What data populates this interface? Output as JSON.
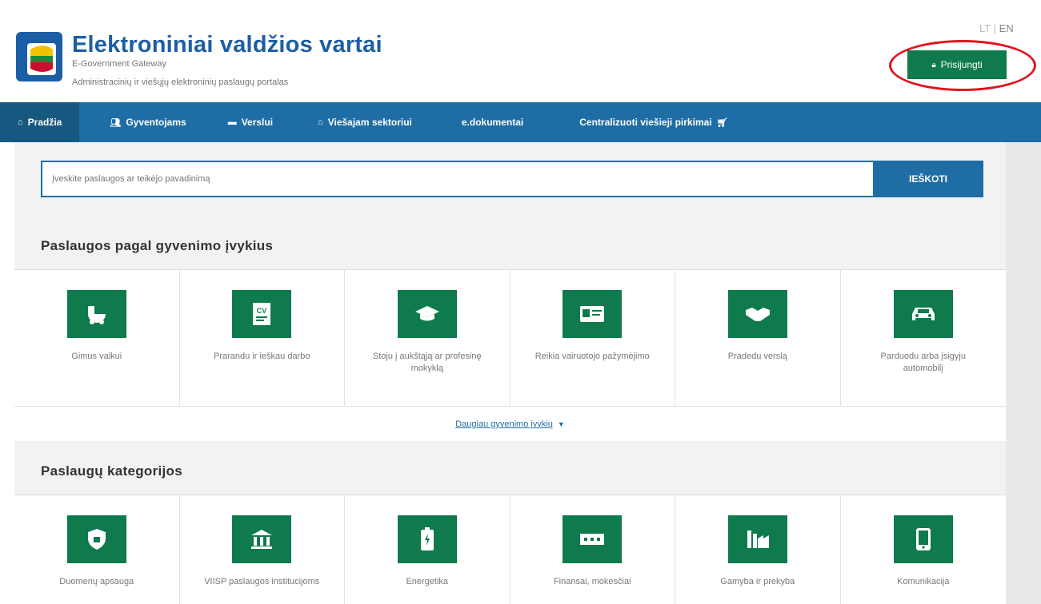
{
  "header": {
    "title": "Elektroniniai valdžios vartai",
    "subtitle": "E-Government Gateway",
    "subtitle2": "Administracinių ir viešųjų elektroninių paslaugų portalas",
    "lang_lt": "LT",
    "lang_en": "EN",
    "login_label": "Prisijungti"
  },
  "nav": {
    "items": [
      {
        "label": "Pradžia",
        "icon": "home-icon"
      },
      {
        "label": "Gyventojams",
        "icon": "people-icon"
      },
      {
        "label": "Verslui",
        "icon": "briefcase-icon"
      },
      {
        "label": "Viešajam sektoriui",
        "icon": "institution-icon"
      },
      {
        "label": "e.dokumentai",
        "icon": ""
      },
      {
        "label": "Centralizuoti viešieji pirkimai",
        "icon": "cart-icon"
      }
    ]
  },
  "search": {
    "placeholder": "Įveskite paslaugos ar teikėjo pavadinimą",
    "button_label": "IEŠKOTI"
  },
  "life_events": {
    "title": "Paslaugos pagal gyvenimo įvykius",
    "items": [
      {
        "label": "Gimus vaikui",
        "icon": "stroller-icon"
      },
      {
        "label": "Prarandu ir ieškau darbo",
        "icon": "cv-icon"
      },
      {
        "label": "Stoju į aukštąją ar profesinę mokyklą",
        "icon": "graduation-cap-icon"
      },
      {
        "label": "Reikia vairuotojo pažymėjimo",
        "icon": "id-card-icon"
      },
      {
        "label": "Pradedu verslą",
        "icon": "handshake-icon"
      },
      {
        "label": "Parduodu arba įsigyju automobilį",
        "icon": "car-icon"
      }
    ],
    "more_label": "Daugiau gyvenimo įvykių"
  },
  "categories": {
    "title": "Paslaugų kategorijos",
    "items": [
      {
        "label": "Duomenų apsauga",
        "icon": "shield-icon"
      },
      {
        "label": "VIISP paslaugos institucijoms",
        "icon": "bank-icon"
      },
      {
        "label": "Energetika",
        "icon": "battery-icon"
      },
      {
        "label": "Finansai, mokesčiai",
        "icon": "money-icon"
      },
      {
        "label": "Gamyba ir prekyba",
        "icon": "factory-icon"
      },
      {
        "label": "Komunikacija",
        "icon": "phone-icon"
      }
    ]
  },
  "colors": {
    "brand_blue": "#1e6ea5",
    "brand_green": "#0f7a4c",
    "highlight_red": "#e3131b"
  }
}
